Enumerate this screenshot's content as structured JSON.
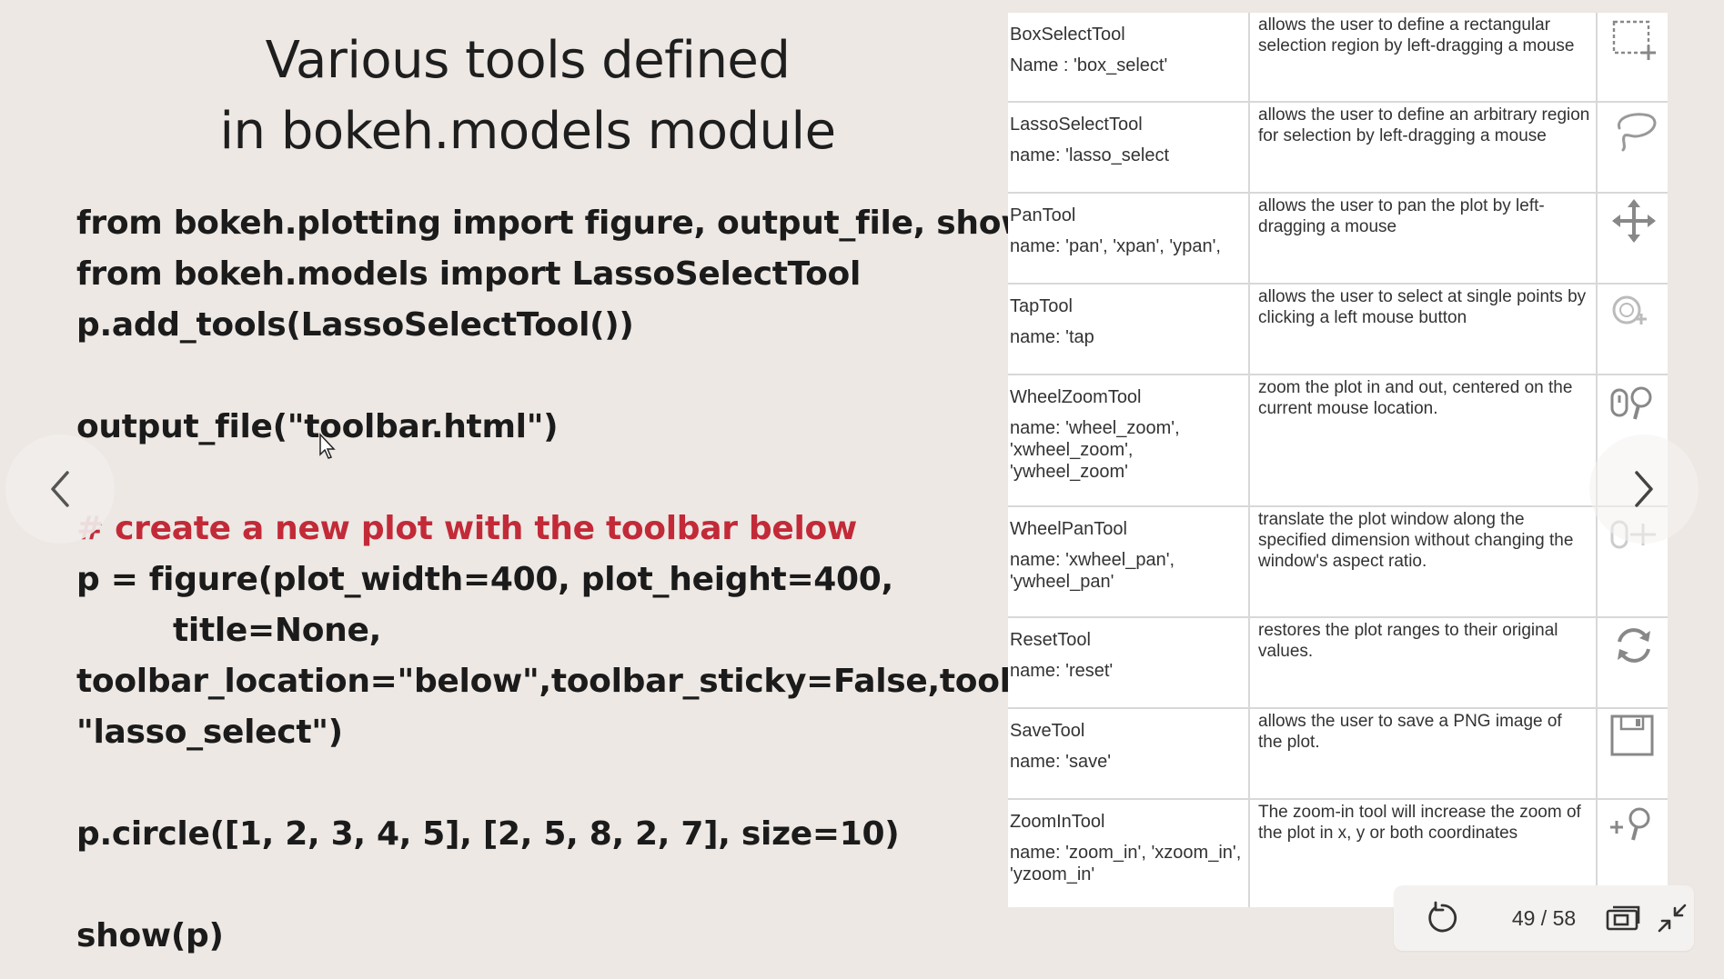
{
  "slide": {
    "title_line1": "Various tools defined",
    "title_line2": "in bokeh.models module"
  },
  "code": {
    "line1": "from bokeh.plotting import figure, output_file, show",
    "line2": "from bokeh.models import LassoSelectTool",
    "line3": "p.add_tools(LassoSelectTool())",
    "line4": "output_file(\"toolbar.html\")",
    "comment": "# create a new plot with the toolbar below",
    "line5": "p = figure(plot_width=400, plot_height=400,",
    "line6": "title=None,",
    "line7": "toolbar_location=\"below\",toolbar_sticky=False,tools=",
    "line8": "\"lasso_select\")",
    "line9": "p.circle([1, 2, 3, 4, 5], [2, 5, 8, 2, 7], size=10)",
    "line10": "show(p)"
  },
  "tools": [
    {
      "name": "BoxSelectTool",
      "id": "Name : 'box_select'",
      "desc": "allows the user to define a rectangular selection region by left-dragging a mouse",
      "icon": "box-select-icon"
    },
    {
      "name": "LassoSelectTool",
      "id": "name: 'lasso_select",
      "desc": "allows the user to define an arbitrary region for selection by left-dragging a mouse",
      "icon": "lasso-icon"
    },
    {
      "name": "PanTool",
      "id": "name: 'pan', 'xpan', 'ypan',",
      "desc": "allows the user to pan the plot by left-dragging a mouse",
      "icon": "pan-icon"
    },
    {
      "name": "TapTool",
      "id": "name: 'tap",
      "desc": "allows the user to select at single points by clicking a left mouse button",
      "icon": "tap-icon"
    },
    {
      "name": "WheelZoomTool",
      "id": "name:               'wheel_zoom', 'xwheel_zoom', 'ywheel_zoom'",
      "desc": "zoom the plot in and out, centered on the current mouse location.",
      "icon": "wheel-zoom-icon"
    },
    {
      "name": "WheelPanTool",
      "id": "name:             'xwheel_pan', 'ywheel_pan'",
      "desc": "translate the plot window along the specified dimension without changing the window's aspect ratio.",
      "icon": "wheel-pan-icon"
    },
    {
      "name": "ResetTool",
      "id": "name: 'reset'",
      "desc": "restores the plot ranges to their original values.",
      "icon": "reset-icon"
    },
    {
      "name": "SaveTool",
      "id": "name: 'save'",
      "desc": "allows the user to save a PNG image of the plot.",
      "icon": "save-icon"
    },
    {
      "name": "ZoomInTool",
      "id": "name: 'zoom_in', 'xzoom_in', 'yzoom_in'",
      "desc": "The zoom-in tool will increase the zoom of the plot in x, y or both coordinates",
      "icon": "zoom-in-icon"
    }
  ],
  "controls": {
    "page_counter": "49 / 58"
  }
}
